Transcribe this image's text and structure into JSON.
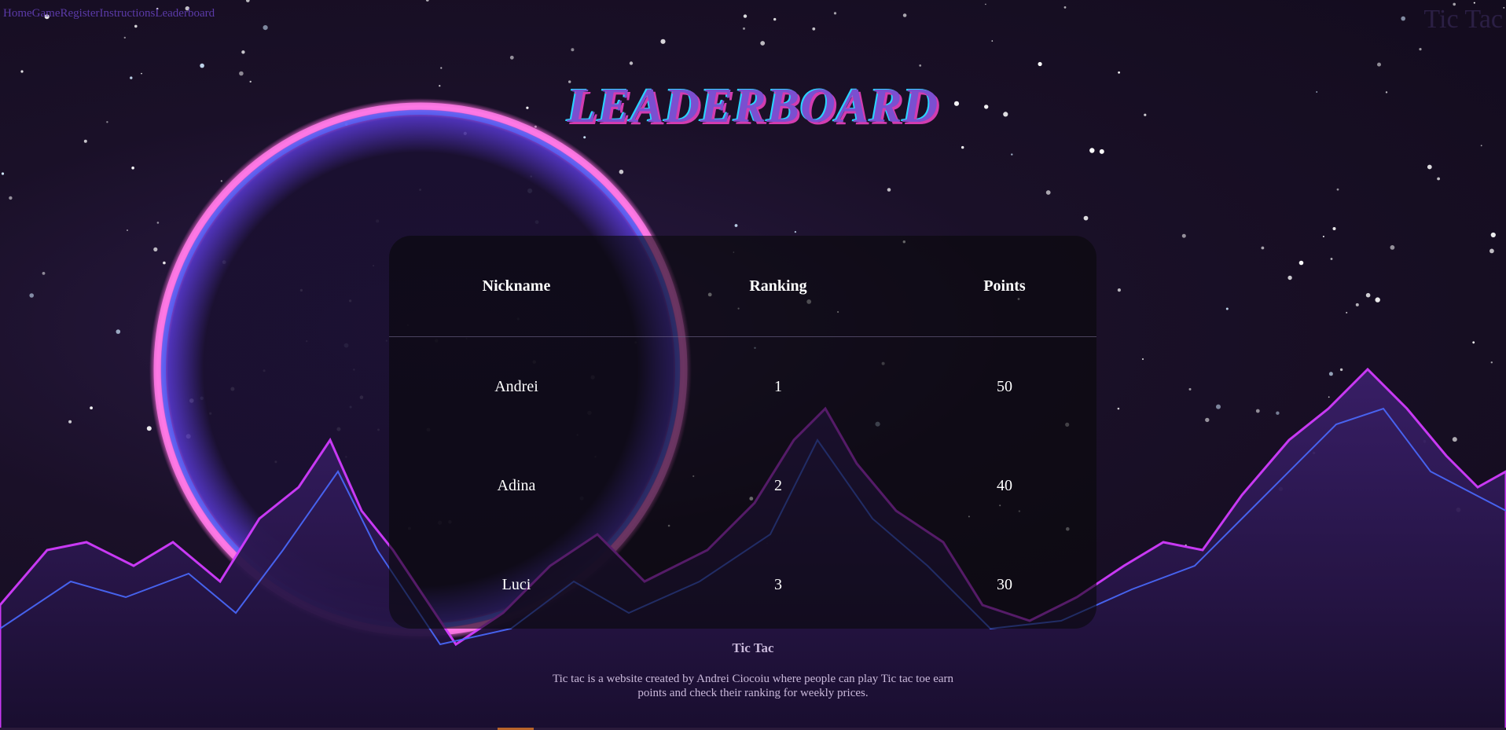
{
  "nav": {
    "items": [
      "Home",
      "Game",
      "Register",
      "Instructions",
      "Leaderboard"
    ]
  },
  "brand": "Tic Tac",
  "page_title": "LEADERBOARD",
  "leaderboard": {
    "headers": [
      "Nickname",
      "Ranking",
      "Points"
    ],
    "rows": [
      {
        "nickname": "Andrei",
        "ranking": "1",
        "points": "50"
      },
      {
        "nickname": "Adina",
        "ranking": "2",
        "points": "40"
      },
      {
        "nickname": "Luci",
        "ranking": "3",
        "points": "30"
      }
    ]
  },
  "footer": {
    "title": "Tic Tac",
    "text": "Tic tac is a website created by Andrei Ciocoiu where people can play Tic tac toe earn points and check their ranking for weekly prices."
  },
  "colors": {
    "nav_link": "#5b3aa8",
    "title": "#7b4fd0",
    "title_shadow": "#d23cb0",
    "planet_ring": "#ff5fd8",
    "mountain_neon": "#d23cff"
  }
}
